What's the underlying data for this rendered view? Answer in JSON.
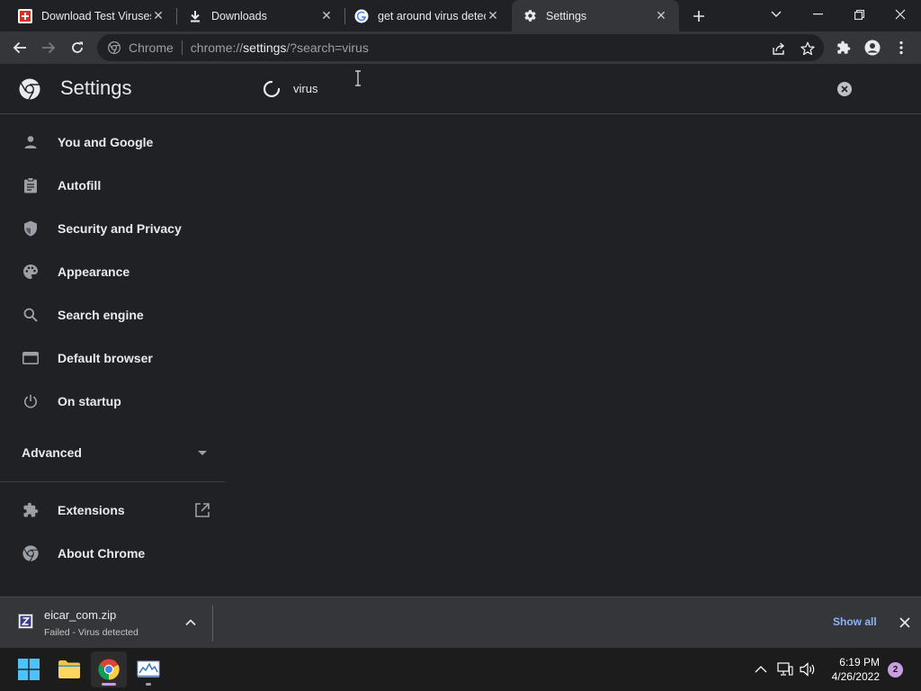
{
  "browser": {
    "tabs": [
      {
        "title": "Download Test Viruses",
        "icon": "eicar-favicon",
        "active": false
      },
      {
        "title": "Downloads",
        "icon": "download-icon",
        "active": false
      },
      {
        "title": "get around virus detec",
        "icon": "google-icon",
        "active": false
      },
      {
        "title": "Settings",
        "icon": "gear-icon",
        "active": true
      }
    ],
    "address_bar": {
      "site_chip": "Chrome",
      "url_scheme": "chrome://",
      "url_host": "settings",
      "url_rest": "/?search=virus"
    }
  },
  "settings": {
    "title": "Settings",
    "search": {
      "value": "virus",
      "loading": true
    },
    "nav": [
      {
        "label": "You and Google",
        "icon": "person-icon"
      },
      {
        "label": "Autofill",
        "icon": "clipboard-icon"
      },
      {
        "label": "Security and Privacy",
        "icon": "shield-icon"
      },
      {
        "label": "Appearance",
        "icon": "palette-icon"
      },
      {
        "label": "Search engine",
        "icon": "search-icon"
      },
      {
        "label": "Default browser",
        "icon": "browser-window-icon"
      },
      {
        "label": "On startup",
        "icon": "power-icon"
      }
    ],
    "advanced_label": "Advanced",
    "extensions_label": "Extensions",
    "about_label": "About Chrome"
  },
  "download_shelf": {
    "file_name": "eicar_com.zip",
    "status": "Failed - Virus detected",
    "show_all_label": "Show all"
  },
  "taskbar": {
    "time": "6:19 PM",
    "date": "4/26/2022",
    "notification_count": "2"
  },
  "colors": {
    "background": "#202124",
    "toolbar": "#35363a",
    "link": "#8ab4f8",
    "notification_badge": "#c99ee0"
  }
}
